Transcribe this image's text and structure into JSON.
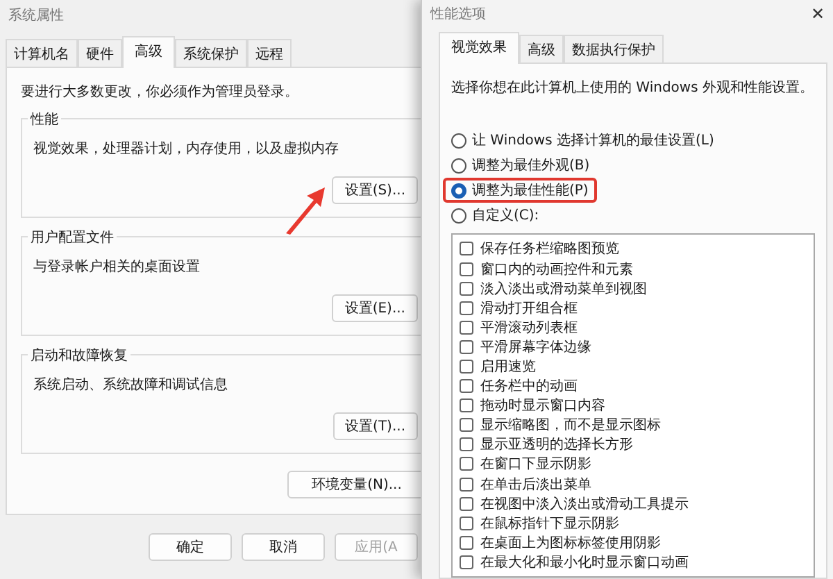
{
  "left_window": {
    "title": "系统属性",
    "tabs": [
      {
        "label": "计算机名",
        "selected": false
      },
      {
        "label": "硬件",
        "selected": false
      },
      {
        "label": "高级",
        "selected": true
      },
      {
        "label": "系统保护",
        "selected": false
      },
      {
        "label": "远程",
        "selected": false
      }
    ],
    "notice": "要进行大多数更改，你必须作为管理员登录。",
    "groups": [
      {
        "title": "性能",
        "description": "视觉效果，处理器计划，内存使用，以及虚拟内存",
        "button": "设置(S)...",
        "pointed_at": true
      },
      {
        "title": "用户配置文件",
        "description": "与登录帐户相关的桌面设置",
        "button": "设置(E)...",
        "pointed_at": false
      },
      {
        "title": "启动和故障恢复",
        "description": "系统启动、系统故障和调试信息",
        "button": "设置(T)...",
        "pointed_at": false
      }
    ],
    "env_button": "环境变量(N)...",
    "footer_buttons": [
      {
        "label": "确定",
        "disabled": false
      },
      {
        "label": "取消",
        "disabled": false
      },
      {
        "label": "应用(A",
        "disabled": true
      }
    ]
  },
  "right_window": {
    "title": "性能选项",
    "close": "✕",
    "tabs": [
      {
        "label": "视觉效果",
        "selected": true
      },
      {
        "label": "高级",
        "selected": false
      },
      {
        "label": "数据执行保护",
        "selected": false
      }
    ],
    "intro": "选择你想在此计算机上使用的 Windows 外观和性能设置。",
    "options": [
      {
        "label": "让 Windows 选择计算机的最佳设置(L)",
        "selected": false,
        "highlighted": false
      },
      {
        "label": "调整为最佳外观(B)",
        "selected": false,
        "highlighted": false
      },
      {
        "label": "调整为最佳性能(P)",
        "selected": true,
        "highlighted": true
      },
      {
        "label": "自定义(C):",
        "selected": false,
        "highlighted": false
      }
    ],
    "effects": [
      {
        "label": "保存任务栏缩略图预览",
        "checked": false
      },
      {
        "label": "窗口内的动画控件和元素",
        "checked": false
      },
      {
        "label": "淡入淡出或滑动菜单到视图",
        "checked": false
      },
      {
        "label": "滑动打开组合框",
        "checked": false
      },
      {
        "label": "平滑滚动列表框",
        "checked": false
      },
      {
        "label": "平滑屏幕字体边缘",
        "checked": false
      },
      {
        "label": "启用速览",
        "checked": false
      },
      {
        "label": "任务栏中的动画",
        "checked": false
      },
      {
        "label": "拖动时显示窗口内容",
        "checked": false
      },
      {
        "label": "显示缩略图，而不是显示图标",
        "checked": false
      },
      {
        "label": "显示亚透明的选择长方形",
        "checked": false
      },
      {
        "label": "在窗口下显示阴影",
        "checked": false
      },
      {
        "label": "在单击后淡出菜单",
        "checked": false
      },
      {
        "label": "在视图中淡入淡出或滑动工具提示",
        "checked": false
      },
      {
        "label": "在鼠标指针下显示阴影",
        "checked": false
      },
      {
        "label": "在桌面上为图标标签使用阴影",
        "checked": false
      },
      {
        "label": "在最大化和最小化时显示窗口动画",
        "checked": false
      }
    ]
  }
}
